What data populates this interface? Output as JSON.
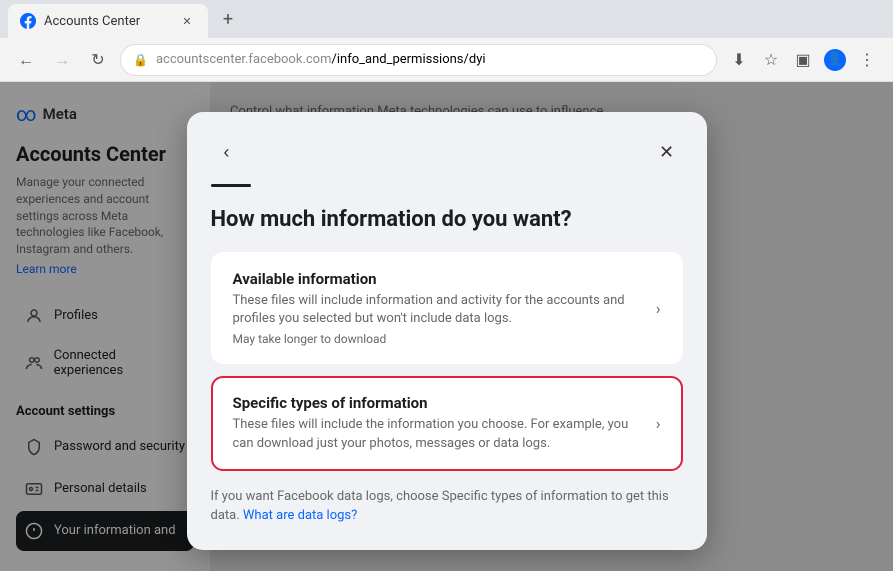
{
  "browser": {
    "tab": {
      "title": "Accounts Center",
      "favicon_label": "facebook-favicon"
    },
    "tab_new_label": "+",
    "nav": {
      "back_label": "←",
      "forward_label": "→",
      "refresh_label": "↻",
      "address": "accountscenter.facebook.com/info_and_permissions/dyi",
      "address_host": "accountscenter.facebook.com",
      "address_path": "/info_and_permissions/dyi",
      "download_icon_label": "⬇",
      "star_icon_label": "☆",
      "sidebar_icon_label": "▣",
      "profile_icon_label": "👤",
      "more_icon_label": "⋮"
    }
  },
  "sidebar": {
    "meta_logo": "∞",
    "meta_label": "Meta",
    "heading": "Accounts Center",
    "description": "Manage your connected experiences and account settings across Meta technologies like Facebook, Instagram and others.",
    "learn_more": "Learn more",
    "items": [
      {
        "id": "profiles",
        "icon": "person",
        "label": "Profiles"
      },
      {
        "id": "connected",
        "icon": "people",
        "label": "Connected experiences"
      }
    ],
    "account_settings_title": "Account settings",
    "account_items": [
      {
        "id": "password",
        "icon": "shield",
        "label": "Password and security"
      },
      {
        "id": "personal",
        "icon": "id-card",
        "label": "Personal details"
      },
      {
        "id": "your-info",
        "icon": "info",
        "label": "Your information and",
        "active": true
      }
    ]
  },
  "main": {
    "body_text": "Control what information Meta technologies can use to influence your experience"
  },
  "modal": {
    "back_label": "‹",
    "close_label": "✕",
    "title": "How much information do you want?",
    "options": [
      {
        "id": "available",
        "title": "Available information",
        "description": "These files will include information and activity for the accounts and profiles you selected but won't include data logs.",
        "subtitle": "May take longer to download",
        "highlighted": false
      },
      {
        "id": "specific",
        "title": "Specific types of information",
        "description": "These files will include the information you choose. For example, you can download just your photos, messages or data logs.",
        "subtitle": "",
        "highlighted": true
      }
    ],
    "footer_text": "If you want Facebook data logs, choose Specific types of information to get this data.",
    "footer_link": "What are data logs?"
  }
}
